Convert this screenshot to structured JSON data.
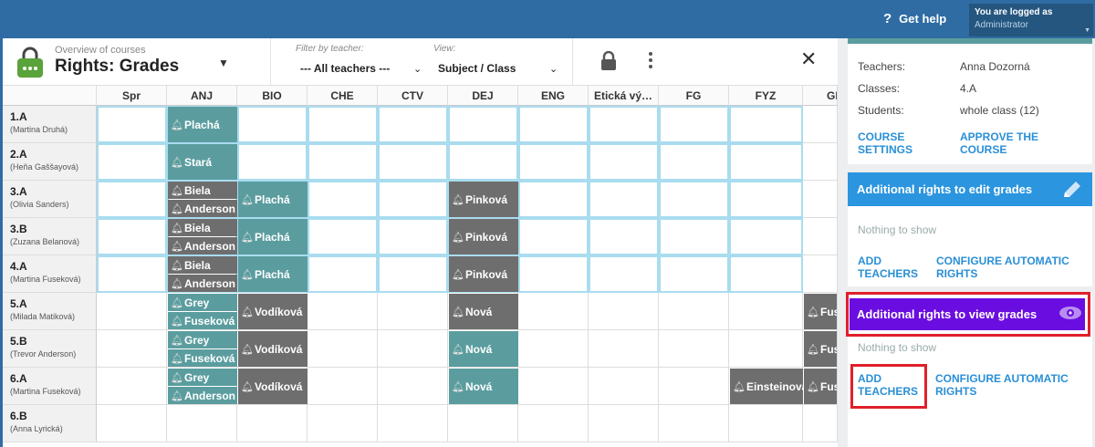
{
  "topbar": {
    "help_label": "Get help",
    "login_line1": "You are logged as",
    "login_line2": "Administrator"
  },
  "header": {
    "subtitle": "Overview of courses",
    "title": "Rights: Grades",
    "filter_label": "Filter by teacher:",
    "filter_value": "--- All teachers ---",
    "view_label": "View:",
    "view_value": "Subject / Class"
  },
  "columns": [
    "Spr",
    "ANJ",
    "BIO",
    "CHE",
    "CTV",
    "DEJ",
    "ENG",
    "Etická vý…",
    "FG",
    "FYZ",
    "GE"
  ],
  "rows": [
    {
      "cls": "1.A",
      "teacher": "(Martina Druhá)"
    },
    {
      "cls": "2.A",
      "teacher": "(Heňa Gaššayová)"
    },
    {
      "cls": "3.A",
      "teacher": "(Olivia Sanders)"
    },
    {
      "cls": "3.B",
      "teacher": "(Zuzana Belanová)"
    },
    {
      "cls": "4.A",
      "teacher": "(Martina Fuseková)"
    },
    {
      "cls": "5.A",
      "teacher": "(Milada Matiková)"
    },
    {
      "cls": "5.B",
      "teacher": "(Trevor Anderson)"
    },
    {
      "cls": "6.A",
      "teacher": "(Martina Fuseková)"
    },
    {
      "cls": "6.B",
      "teacher": "(Anna Lyrická)"
    }
  ],
  "chips": {
    "r0_anj": "Plachá",
    "r1_anj": "Stará",
    "r2_anj_a": "Biela",
    "r2_anj_b": "Anderson",
    "r2_bio": "Plachá",
    "r2_dej": "Pinková",
    "r3_anj_a": "Biela",
    "r3_anj_b": "Anderson",
    "r3_bio": "Plachá",
    "r3_dej": "Pinková",
    "r4_anj_a": "Biela",
    "r4_anj_b": "Anderson",
    "r4_bio": "Plachá",
    "r4_dej": "Pinková",
    "r5_anj_a": "Grey",
    "r5_anj_b": "Fuseková",
    "r5_bio": "Vodíková",
    "r5_dej": "Nová",
    "r5_ge": "Fus",
    "r6_anj_a": "Grey",
    "r6_anj_b": "Fuseková",
    "r6_bio": "Vodíková",
    "r6_dej": "Nová",
    "r6_ge": "Fus",
    "r7_anj_a": "Grey",
    "r7_anj_b": "Anderson",
    "r7_bio": "Vodíková",
    "r7_dej": "Nová",
    "r7_fyz": "Einsteinová",
    "r7_ge": "Fus"
  },
  "panel": {
    "teachers_label": "Teachers:",
    "teachers_value": "Anna Dozorná",
    "classes_label": "Classes:",
    "classes_value": "4.A",
    "students_label": "Students:",
    "students_value": "whole class (12)",
    "course_settings": "COURSE SETTINGS",
    "approve_course": "APPROVE THE COURSE",
    "edit_grades_title": "Additional rights to edit grades",
    "nothing1": "Nothing to show",
    "add_teachers1": "ADD TEACHERS",
    "configure1": "CONFIGURE AUTOMATIC RIGHTS",
    "view_grades_title": "Additional rights to view grades",
    "nothing2": "Nothing to show",
    "add_teachers2": "ADD TEACHERS",
    "configure2": "CONFIGURE AUTOMATIC RIGHTS"
  },
  "colors": {
    "teal": "#5b9d9f",
    "gray": "#6e6e6e",
    "blue": "#2b95df",
    "purple": "#6a0de0",
    "red": "#e0202a"
  }
}
